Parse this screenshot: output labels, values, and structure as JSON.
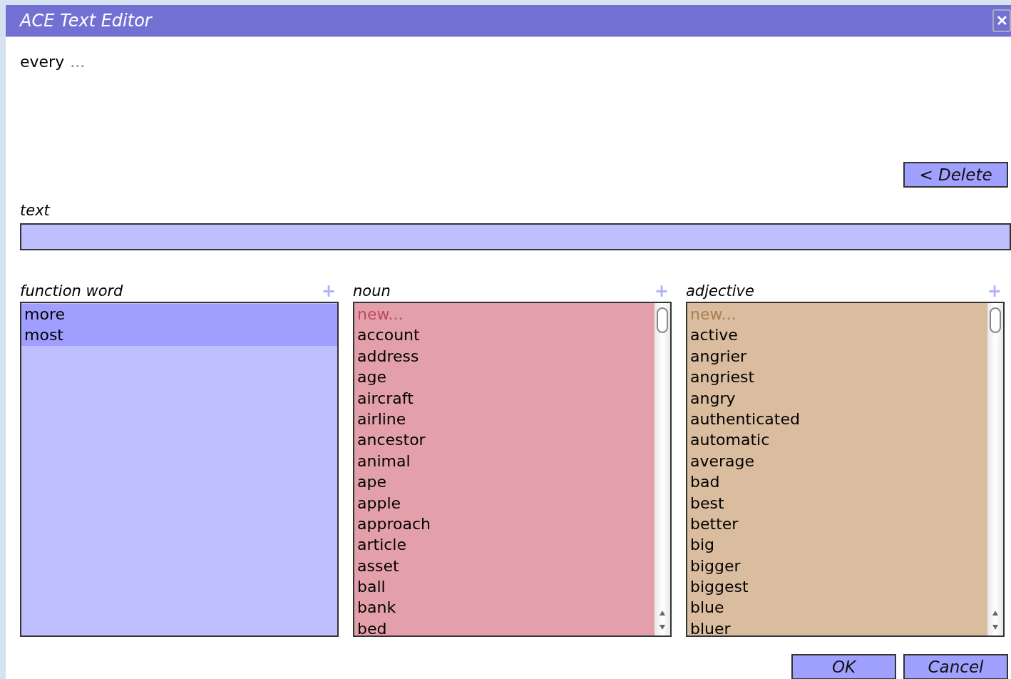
{
  "window": {
    "title": "ACE Text Editor",
    "close": "✕"
  },
  "sentence": [
    {
      "text": "every",
      "kind": "word"
    },
    {
      "text": "...",
      "kind": "ellipsis"
    }
  ],
  "delete_button": "< Delete",
  "text_field": {
    "label": "text"
  },
  "lists": [
    {
      "label": "function word",
      "add": "+",
      "color": "#bfbfff",
      "scrollbar": false,
      "items": [
        {
          "text": "more",
          "kind": "word",
          "selected": true
        },
        {
          "text": "most",
          "kind": "word",
          "selected": true
        }
      ]
    },
    {
      "label": "noun",
      "add": "+",
      "color": "#e4a0aa",
      "scrollbar": true,
      "items": [
        {
          "text": "new...",
          "kind": "new",
          "selected": false
        },
        {
          "text": "account",
          "kind": "word",
          "selected": false
        },
        {
          "text": "address",
          "kind": "word",
          "selected": false
        },
        {
          "text": "age",
          "kind": "word",
          "selected": false
        },
        {
          "text": "aircraft",
          "kind": "word",
          "selected": false
        },
        {
          "text": "airline",
          "kind": "word",
          "selected": false
        },
        {
          "text": "ancestor",
          "kind": "word",
          "selected": false
        },
        {
          "text": "animal",
          "kind": "word",
          "selected": false
        },
        {
          "text": "ape",
          "kind": "word",
          "selected": false
        },
        {
          "text": "apple",
          "kind": "word",
          "selected": false
        },
        {
          "text": "approach",
          "kind": "word",
          "selected": false
        },
        {
          "text": "article",
          "kind": "word",
          "selected": false
        },
        {
          "text": "asset",
          "kind": "word",
          "selected": false
        },
        {
          "text": "ball",
          "kind": "word",
          "selected": false
        },
        {
          "text": "bank",
          "kind": "word",
          "selected": false
        },
        {
          "text": "bed",
          "kind": "word",
          "selected": false
        }
      ]
    },
    {
      "label": "adjective",
      "add": "+",
      "color": "#d9bd9e",
      "scrollbar": true,
      "items": [
        {
          "text": "new...",
          "kind": "new",
          "selected": false
        },
        {
          "text": "active",
          "kind": "word",
          "selected": false
        },
        {
          "text": "angrier",
          "kind": "word",
          "selected": false
        },
        {
          "text": "angriest",
          "kind": "word",
          "selected": false
        },
        {
          "text": "angry",
          "kind": "word",
          "selected": false
        },
        {
          "text": "authenticated",
          "kind": "word",
          "selected": false
        },
        {
          "text": "automatic",
          "kind": "word",
          "selected": false
        },
        {
          "text": "average",
          "kind": "word",
          "selected": false
        },
        {
          "text": "bad",
          "kind": "word",
          "selected": false
        },
        {
          "text": "best",
          "kind": "word",
          "selected": false
        },
        {
          "text": "better",
          "kind": "word",
          "selected": false
        },
        {
          "text": "big",
          "kind": "word",
          "selected": false
        },
        {
          "text": "bigger",
          "kind": "word",
          "selected": false
        },
        {
          "text": "biggest",
          "kind": "word",
          "selected": false
        },
        {
          "text": "blue",
          "kind": "word",
          "selected": false
        },
        {
          "text": "bluer",
          "kind": "word",
          "selected": false
        }
      ]
    }
  ],
  "buttons": [
    "OK",
    "Cancel"
  ]
}
